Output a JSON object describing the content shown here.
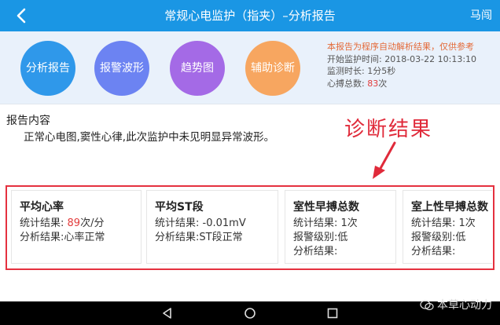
{
  "header": {
    "title": "常规心电监护（指夹）–分析报告",
    "user": "马闯"
  },
  "toolbar": {
    "buttons": [
      {
        "label": "分析报告",
        "color": "#2f98ea"
      },
      {
        "label": "报警波形",
        "color": "#6c83f2"
      },
      {
        "label": "趋势图",
        "color": "#a46ae6"
      },
      {
        "label": "辅助诊断",
        "color": "#f7a660"
      }
    ]
  },
  "info": {
    "notice": "本报告为程序自动解析结果，仅供参考",
    "start_label": "开始监护时间:",
    "start_value": "2018-03-22 10:13:10",
    "duration_label": "监测时长:",
    "duration_value": "1分5秒",
    "beats_label": "心搏总数:",
    "beats_value": "83",
    "beats_unit": "次"
  },
  "report": {
    "title": "报告内容",
    "text": "正常心电图,窦性心律,此次监护中未见明显异常波形。"
  },
  "annotation": {
    "text": "诊断结果",
    "color": "#e02a3a"
  },
  "cards": [
    {
      "title": "平均心率",
      "stat_label": "统计结果:",
      "stat_value": "89",
      "stat_unit": "次/分",
      "result_label": "分析结果:",
      "result_value": "心率正常"
    },
    {
      "title": "平均ST段",
      "stat_label": "统计结果:",
      "stat_value": "-0.01mV",
      "result_label": "分析结果:",
      "result_value": "ST段正常"
    },
    {
      "title": "室性早搏总数",
      "stat_label": "统计结果:",
      "stat_value": "1次",
      "alarm_label": "报警级别:",
      "alarm_value": "低",
      "result_label": "分析结果:",
      "result_value": ""
    },
    {
      "title": "室上性早搏总数",
      "stat_label": "统计结果:",
      "stat_value": "1次",
      "alarm_label": "报警级别:",
      "alarm_value": "低",
      "result_label": "分析结果:",
      "result_value": ""
    }
  ],
  "watermark": {
    "text": "本草心动力"
  },
  "colors": {
    "header_bg": "#1a96e4",
    "toolbar_bg": "#e9f1fb",
    "highlight_red": "#e23b3b",
    "box_red": "#e5313f"
  }
}
